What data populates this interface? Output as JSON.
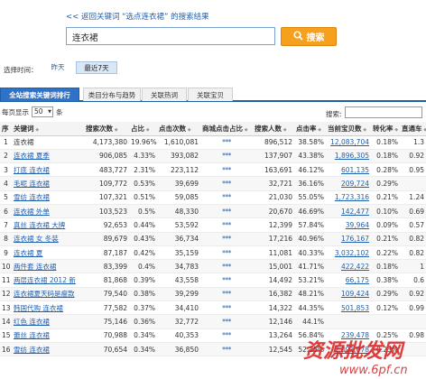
{
  "header": {
    "back_link": "<< 返回关键词 “选点连衣裙” 的搜索结果",
    "search_value": "连衣裙",
    "search_button": "搜索"
  },
  "time_filter": {
    "label": "选择时间：",
    "yesterday": "昨天",
    "last7": "最近7天"
  },
  "tabs": [
    "全站搜索关键词排行",
    "类目分布与趋势",
    "关联热词",
    "关联宝贝"
  ],
  "table_controls": {
    "per_page_prefix": "每页显示",
    "per_page_value": "50",
    "per_page_suffix": "条",
    "search_label": "搜索:"
  },
  "table": {
    "columns": [
      "序",
      "关键词",
      "搜索次数",
      "占比",
      "点击次数",
      "商城点击占比",
      "搜索人数",
      "点击率",
      "当前宝贝数",
      "转化率",
      "直通车"
    ],
    "rows": [
      [
        "1",
        "连衣裙",
        "4,173,380",
        "19.96%",
        "1,610,081",
        "***",
        "896,512",
        "38.58%",
        "12,083,704",
        "0.18%",
        "1.3"
      ],
      [
        "2",
        "连衣裙 夏季",
        "906,085",
        "4.33%",
        "393,082",
        "***",
        "137,907",
        "43.38%",
        "1,896,305",
        "0.18%",
        "0.92"
      ],
      [
        "3",
        "打底 连衣裙",
        "483,727",
        "2.31%",
        "223,112",
        "***",
        "163,691",
        "46.12%",
        "601,135",
        "0.28%",
        "0.95"
      ],
      [
        "4",
        "毛呢 连衣裙",
        "109,772",
        "0.53%",
        "39,699",
        "***",
        "32,721",
        "36.16%",
        "209,724",
        "0.29%",
        ""
      ],
      [
        "5",
        "雪纺 连衣裙",
        "107,321",
        "0.51%",
        "59,085",
        "***",
        "21,030",
        "55.05%",
        "1,723,316",
        "0.21%",
        "1.24"
      ],
      [
        "6",
        "连衣裙 外单",
        "103,523",
        "0.5%",
        "48,330",
        "***",
        "20,670",
        "46.69%",
        "142,477",
        "0.10%",
        "0.69"
      ],
      [
        "7",
        "真丝 连衣裙 大牌",
        "92,653",
        "0.44%",
        "53,592",
        "***",
        "12,399",
        "57.84%",
        "39,964",
        "0.09%",
        "0.57"
      ],
      [
        "8",
        "连衣裙 女 冬装",
        "89,679",
        "0.43%",
        "36,734",
        "***",
        "17,216",
        "40.96%",
        "176,167",
        "0.21%",
        "0.82"
      ],
      [
        "9",
        "连衣裙 夏",
        "87,187",
        "0.42%",
        "35,159",
        "***",
        "11,081",
        "40.33%",
        "3,032,102",
        "0.22%",
        "0.82"
      ],
      [
        "10",
        "两件套 连衣裙",
        "83,399",
        "0.4%",
        "34,783",
        "***",
        "15,001",
        "41.71%",
        "422,422",
        "0.18%",
        "1"
      ],
      [
        "11",
        "两层连衣裙 2012 新",
        "81,868",
        "0.39%",
        "43,558",
        "***",
        "14,492",
        "53.21%",
        "66,175",
        "0.38%",
        "0.6"
      ],
      [
        "12",
        "连衣裙夏天码是瘦款",
        "79,540",
        "0.38%",
        "39,299",
        "***",
        "16,382",
        "48.21%",
        "109,424",
        "0.29%",
        "0.92"
      ],
      [
        "13",
        "韩国代购 连衣裙",
        "77,582",
        "0.37%",
        "34,410",
        "***",
        "14,322",
        "44.35%",
        "501,853",
        "0.12%",
        "0.99"
      ],
      [
        "14",
        "红色 连衣裙",
        "75,146",
        "0.36%",
        "32,772",
        "***",
        "12,146",
        "44.1%",
        "",
        "",
        ""
      ],
      [
        "15",
        "蕾丝 连衣裙",
        "70,988",
        "0.34%",
        "40,353",
        "***",
        "13,264",
        "56.84%",
        "239,478",
        "0.25%",
        "0.98"
      ],
      [
        "16",
        "雪纺 连衣裙",
        "70,654",
        "0.34%",
        "36,850",
        "***",
        "12,545",
        "52.15%",
        "2,091,078",
        "0.23%",
        ""
      ]
    ]
  },
  "watermark": {
    "text": "资源批发网",
    "url": "www.6pf.cn"
  },
  "colors": {
    "accent_blue": "#1e5fa8",
    "link_blue": "#1f5fb0",
    "search_orange": "#f5a11d"
  }
}
